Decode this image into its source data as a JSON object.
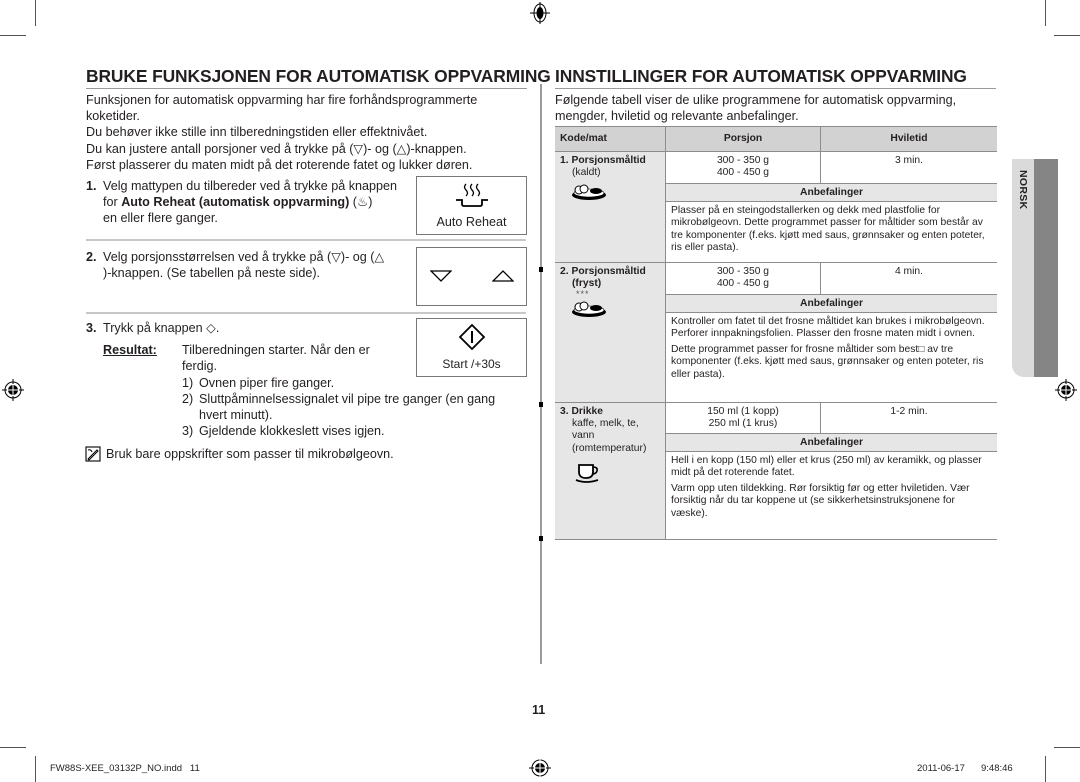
{
  "left": {
    "title": "BRUKE FUNKSJONEN FOR AUTOMATISK OPPVARMING",
    "intro": [
      "Funksjonen for automatisk oppvarming har fire forhåndsprogrammerte",
      "koketider.",
      "Du behøver ikke stille inn tilberedningstiden eller effektnivået.",
      "Du kan justere antall porsjoner ved å trykke på (▽)- og (△)-knappen.",
      "Først plasserer du maten midt på det roterende fatet og lukker døren."
    ],
    "steps": [
      {
        "num": "1.",
        "line1": "Velg mattypen du tilbereder ved å trykke på knappen",
        "line2_pre": "for ",
        "line2_bold": "Auto Reheat (automatisk oppvarming)",
        "line2_post": " (♨)",
        "line3": "en eller flere ganger.",
        "button_label": "Auto Reheat",
        "button_icon": "auto-reheat-icon"
      },
      {
        "num": "2.",
        "line1": "Velg porsjonsstørrelsen ved å trykke på (▽)- og (△",
        "line2": ")-knappen. (Se tabellen på neste side).",
        "button_icons": [
          "down-arrow-icon",
          "up-arrow-icon"
        ]
      },
      {
        "num": "3.",
        "line1": "Trykk på knappen ◇.",
        "result_label": "Resultat:",
        "result_text1": "Tilberedningen starter. Når den er",
        "result_text2": "ferdig.",
        "list": [
          {
            "n": "1)",
            "text": "Ovnen piper fire ganger."
          },
          {
            "n": "2)",
            "text": "Sluttpåminnelsessignalet vil pipe tre ganger (en gang",
            "text2": "hvert minutt)."
          },
          {
            "n": "3)",
            "text": "Gjeldende klokkeslett vises igjen."
          }
        ],
        "button_label": "Start /+30s",
        "button_icon": "start-icon"
      }
    ],
    "note": "Bruk bare oppskrifter som passer til mikrobølgeovn."
  },
  "right": {
    "title": "INNSTILLINGER FOR AUTOMATISK OPPVARMING",
    "intro": [
      "Følgende tabell viser de ulike programmene for automatisk oppvarming,",
      "mengder, hviletid og relevante anbefalinger."
    ],
    "table": {
      "headers": [
        "Kode/mat",
        "Porsjon",
        "Hviletid"
      ],
      "rec_header": "Anbefalinger",
      "rows": [
        {
          "code": "1. Porsjonsmåltid",
          "sub": [
            "(kaldt)"
          ],
          "portions": [
            "300 - 350 g",
            "400 - 450 g"
          ],
          "rest": "3 min.",
          "icon": "plate-meal-icon",
          "recommendations": [
            "Plasser på en steingodstallerken og dekk med plastfolie for mikrobølgeovn. Dette programmet passer for måltider som består av tre komponenter (f.eks. kjøtt med saus, grønnsaker og enten poteter, ris eller pasta)."
          ]
        },
        {
          "code": "2. Porsjonsmåltid",
          "sub": [
            "(fryst)"
          ],
          "stars": "***",
          "portions": [
            "300 - 350 g",
            "400 - 450 g"
          ],
          "rest": "4 min.",
          "icon": "plate-meal-icon",
          "recommendations": [
            "Kontroller om fatet til det frosne måltidet kan brukes i mikrobølgeovn. Perforer innpakningsfolien. Plasser den frosne maten midt i ovnen.",
            "Dette programmet passer for frosne måltider som best□ av tre komponenter (f.eks. kjøtt med saus, grønnsaker og enten poteter, ris eller pasta)."
          ]
        },
        {
          "code": "3. Drikke",
          "sub": [
            "kaffe, melk, te,",
            "vann",
            "(romtemperatur)"
          ],
          "portions": [
            "150 ml (1 kopp)",
            "250 ml (1 krus)"
          ],
          "rest": "1-2 min.",
          "icon": "cup-icon",
          "recommendations": [
            "Hell i en kopp (150 ml) eller et krus (250 ml) av keramikk, og plasser midt på det roterende fatet.",
            "Varm opp uten tildekking. Rør forsiktig før og etter hviletiden. Vær forsiktig når du tar koppene ut (se sikkerhetsinstruksjonene for væske)."
          ]
        }
      ]
    }
  },
  "side_tab": "NORSK",
  "page_number": "11",
  "footer": {
    "file": "FW88S-XEE_03132P_NO.indd   11",
    "date": "2011-06-17",
    "time": "9:48:46"
  }
}
